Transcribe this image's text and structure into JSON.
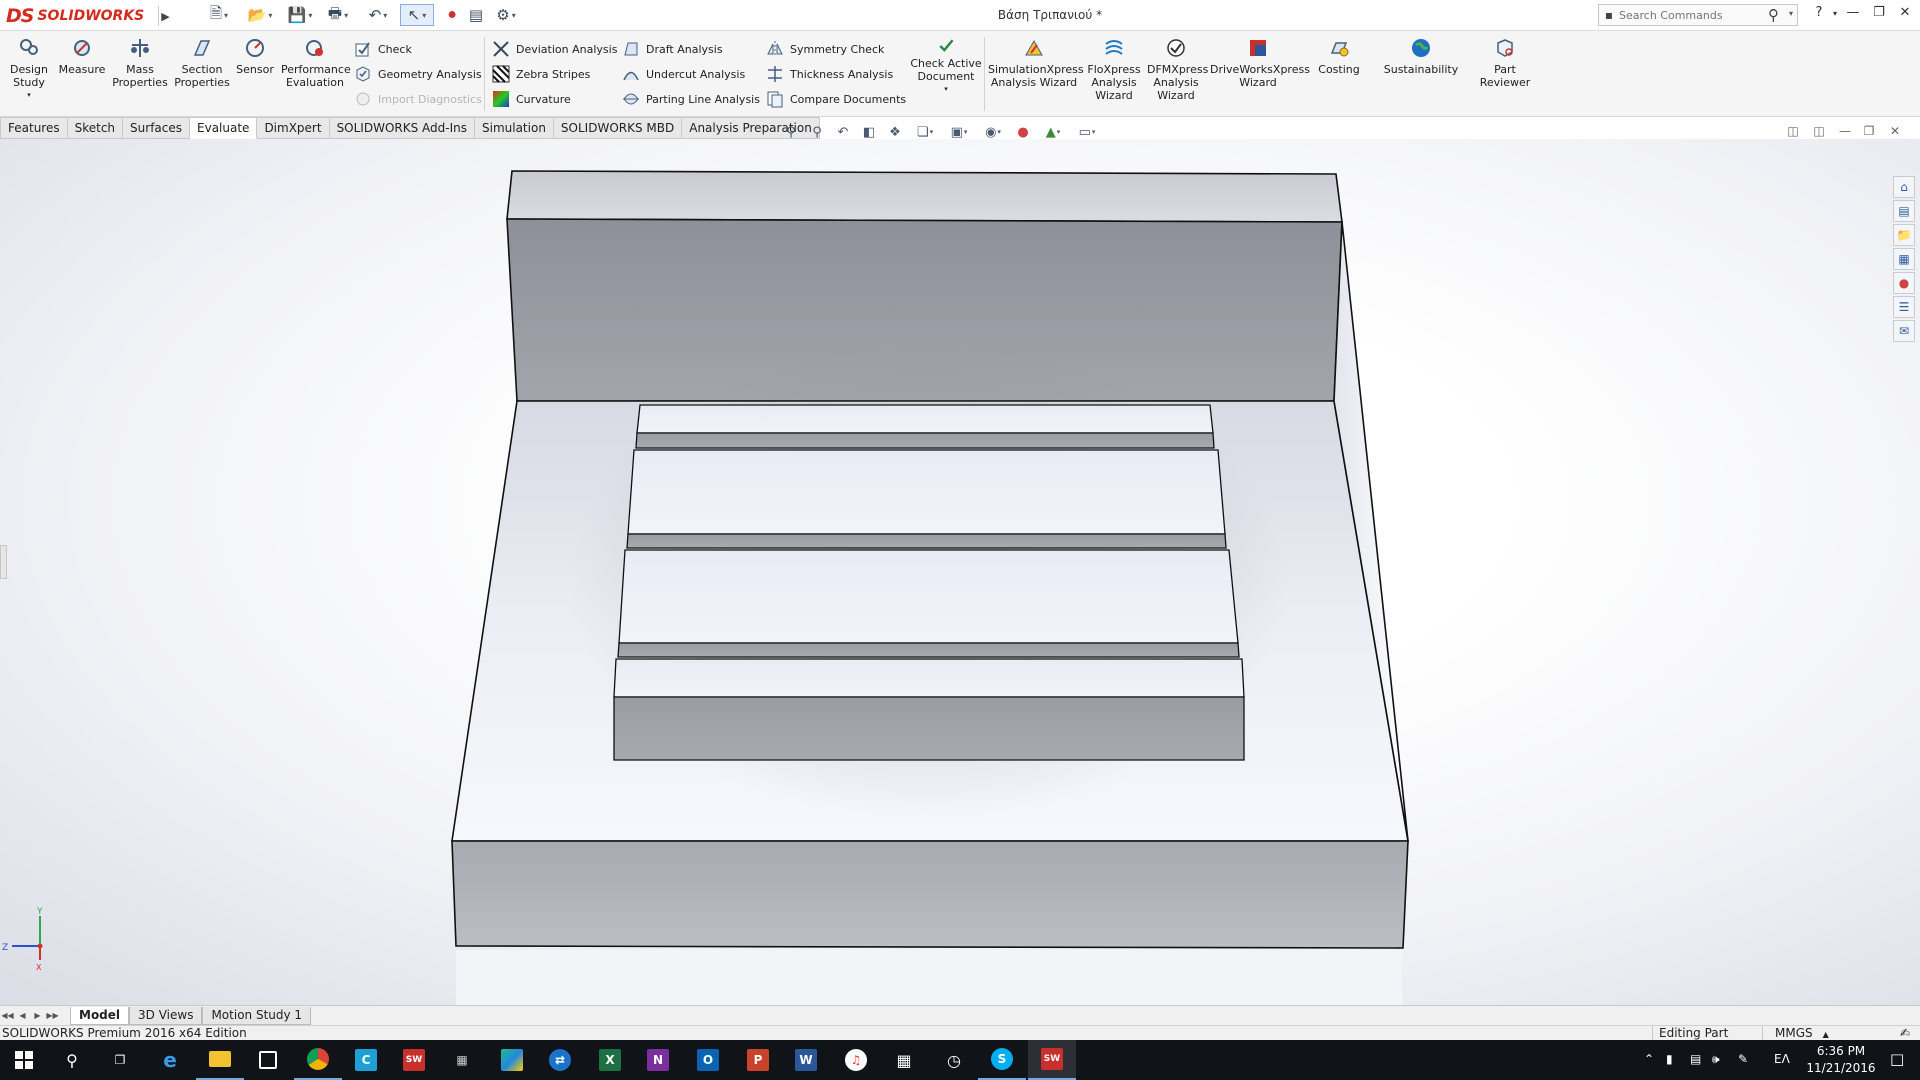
{
  "app": {
    "brand_prefix": "DS",
    "brand_name": "SOLIDWORKS",
    "document_title": "Βάση Τριπανιού *"
  },
  "search": {
    "placeholder": "Search Commands"
  },
  "ribbon": {
    "big_buttons": [
      {
        "label": "Design Study",
        "icon": "design-study-icon"
      },
      {
        "label": "Measure",
        "icon": "measure-icon"
      },
      {
        "label": "Mass Properties",
        "icon": "mass-properties-icon"
      },
      {
        "label": "Section Properties",
        "icon": "section-properties-icon"
      },
      {
        "label": "Sensor",
        "icon": "sensor-icon"
      },
      {
        "label": "Performance Evaluation",
        "icon": "performance-evaluation-icon"
      }
    ],
    "col1": [
      {
        "label": "Check",
        "icon": "check-icon",
        "enabled": true
      },
      {
        "label": "Geometry Analysis",
        "icon": "geometry-analysis-icon",
        "enabled": true
      },
      {
        "label": "Import Diagnostics",
        "icon": "import-diagnostics-icon",
        "enabled": false
      }
    ],
    "col2": [
      {
        "label": "Deviation Analysis",
        "icon": "deviation-analysis-icon"
      },
      {
        "label": "Zebra Stripes",
        "icon": "zebra-stripes-icon"
      },
      {
        "label": "Curvature",
        "icon": "curvature-icon"
      }
    ],
    "col3": [
      {
        "label": "Draft Analysis",
        "icon": "draft-analysis-icon"
      },
      {
        "label": "Undercut Analysis",
        "icon": "undercut-analysis-icon"
      },
      {
        "label": "Parting Line Analysis",
        "icon": "parting-line-analysis-icon"
      }
    ],
    "col4": [
      {
        "label": "Symmetry Check",
        "icon": "symmetry-check-icon"
      },
      {
        "label": "Thickness Analysis",
        "icon": "thickness-analysis-icon"
      },
      {
        "label": "Compare Documents",
        "icon": "compare-documents-icon"
      }
    ],
    "check_active": {
      "label": "Check Active Document",
      "icon": "check-active-document-icon"
    },
    "wizards": [
      {
        "label": "SimulationXpress Analysis Wizard",
        "icon": "simulationxpress-icon"
      },
      {
        "label": "FloXpress Analysis Wizard",
        "icon": "floxpress-icon"
      },
      {
        "label": "DFMXpress Analysis Wizard",
        "icon": "dfmxpress-icon"
      },
      {
        "label": "DriveWorksXpress Wizard",
        "icon": "driveworksxpress-icon"
      },
      {
        "label": "Costing",
        "icon": "costing-icon"
      },
      {
        "label": "Sustainability",
        "icon": "sustainability-icon"
      },
      {
        "label": "Part Reviewer",
        "icon": "part-reviewer-icon"
      }
    ]
  },
  "command_tabs": [
    {
      "label": "Features",
      "active": false
    },
    {
      "label": "Sketch",
      "active": false
    },
    {
      "label": "Surfaces",
      "active": false
    },
    {
      "label": "Evaluate",
      "active": true
    },
    {
      "label": "DimXpert",
      "active": false
    },
    {
      "label": "SOLIDWORKS Add-Ins",
      "active": false
    },
    {
      "label": "Simulation",
      "active": false
    },
    {
      "label": "SOLIDWORKS MBD",
      "active": false
    },
    {
      "label": "Analysis Preparation",
      "active": false
    }
  ],
  "triad": {
    "y_label": "Y",
    "z_label": "Z",
    "x_label": "X"
  },
  "bottom_tabs": [
    {
      "label": "Model",
      "active": true
    },
    {
      "label": "3D Views",
      "active": false
    },
    {
      "label": "Motion Study 1",
      "active": false
    }
  ],
  "status": {
    "product": "SOLIDWORKS Premium 2016 x64 Edition",
    "mode": "Editing Part",
    "units": "MMGS"
  },
  "taskbar": {
    "language": "ΕΛ",
    "time": "6:36 PM",
    "date": "11/21/2016",
    "colors": {
      "excel": "#1d7044",
      "onenote": "#7b2f9e",
      "outlook": "#0a64b4",
      "powerpoint": "#c8432a",
      "word": "#2b579a",
      "solidworks": "#c9302c"
    }
  }
}
